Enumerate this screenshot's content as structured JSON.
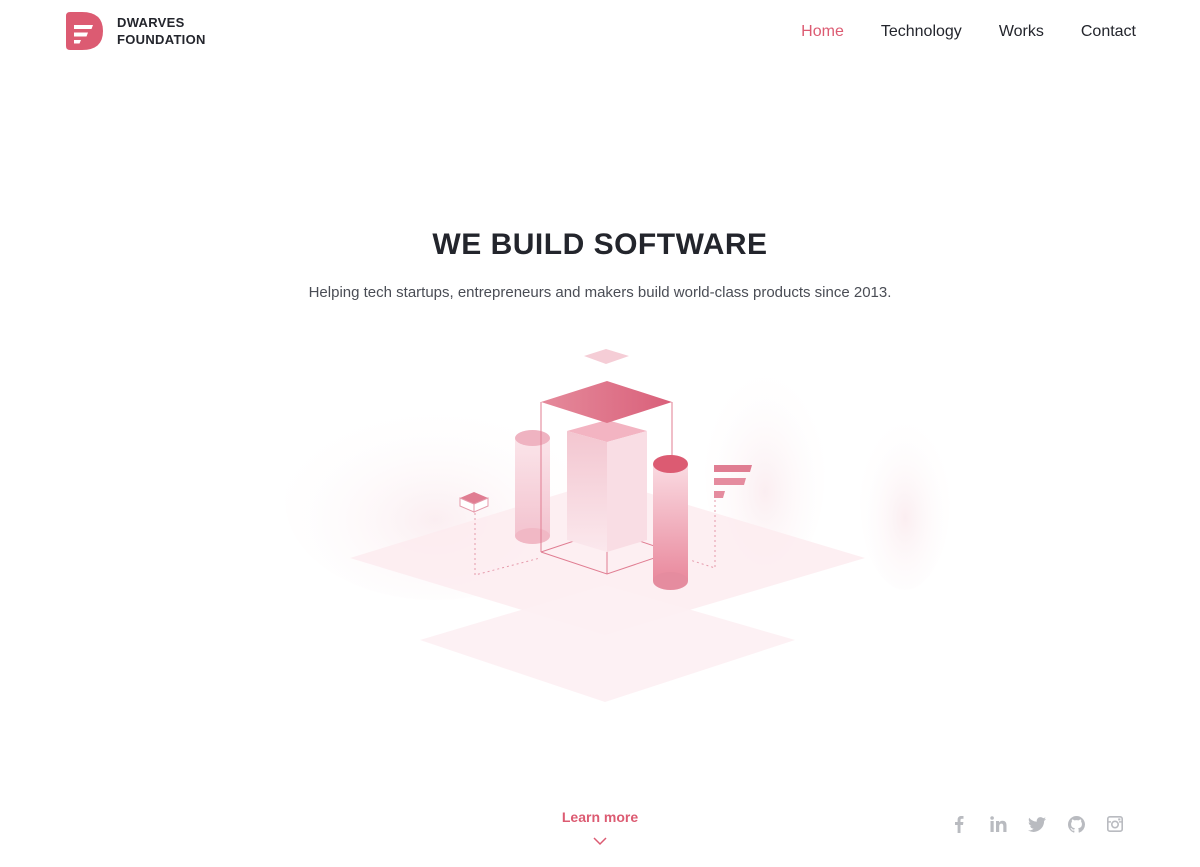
{
  "brand": {
    "name_line1": "DWARVES",
    "name_line2": "FOUNDATION",
    "accent": "#dc5b72"
  },
  "nav": {
    "items": [
      {
        "label": "Home",
        "active": true
      },
      {
        "label": "Technology",
        "active": false
      },
      {
        "label": "Works",
        "active": false
      },
      {
        "label": "Contact",
        "active": false
      }
    ]
  },
  "hero": {
    "title": "WE BUILD SOFTWARE",
    "subtitle": "Helping tech startups, entrepreneurs and makers build world-class products since 2013."
  },
  "cta": {
    "label": "Learn more",
    "icon": "chevron-down-icon"
  },
  "social": {
    "icons": [
      "facebook-icon",
      "linkedin-icon",
      "twitter-icon",
      "github-icon",
      "instagram-icon"
    ],
    "color": "#b9bbc0"
  }
}
